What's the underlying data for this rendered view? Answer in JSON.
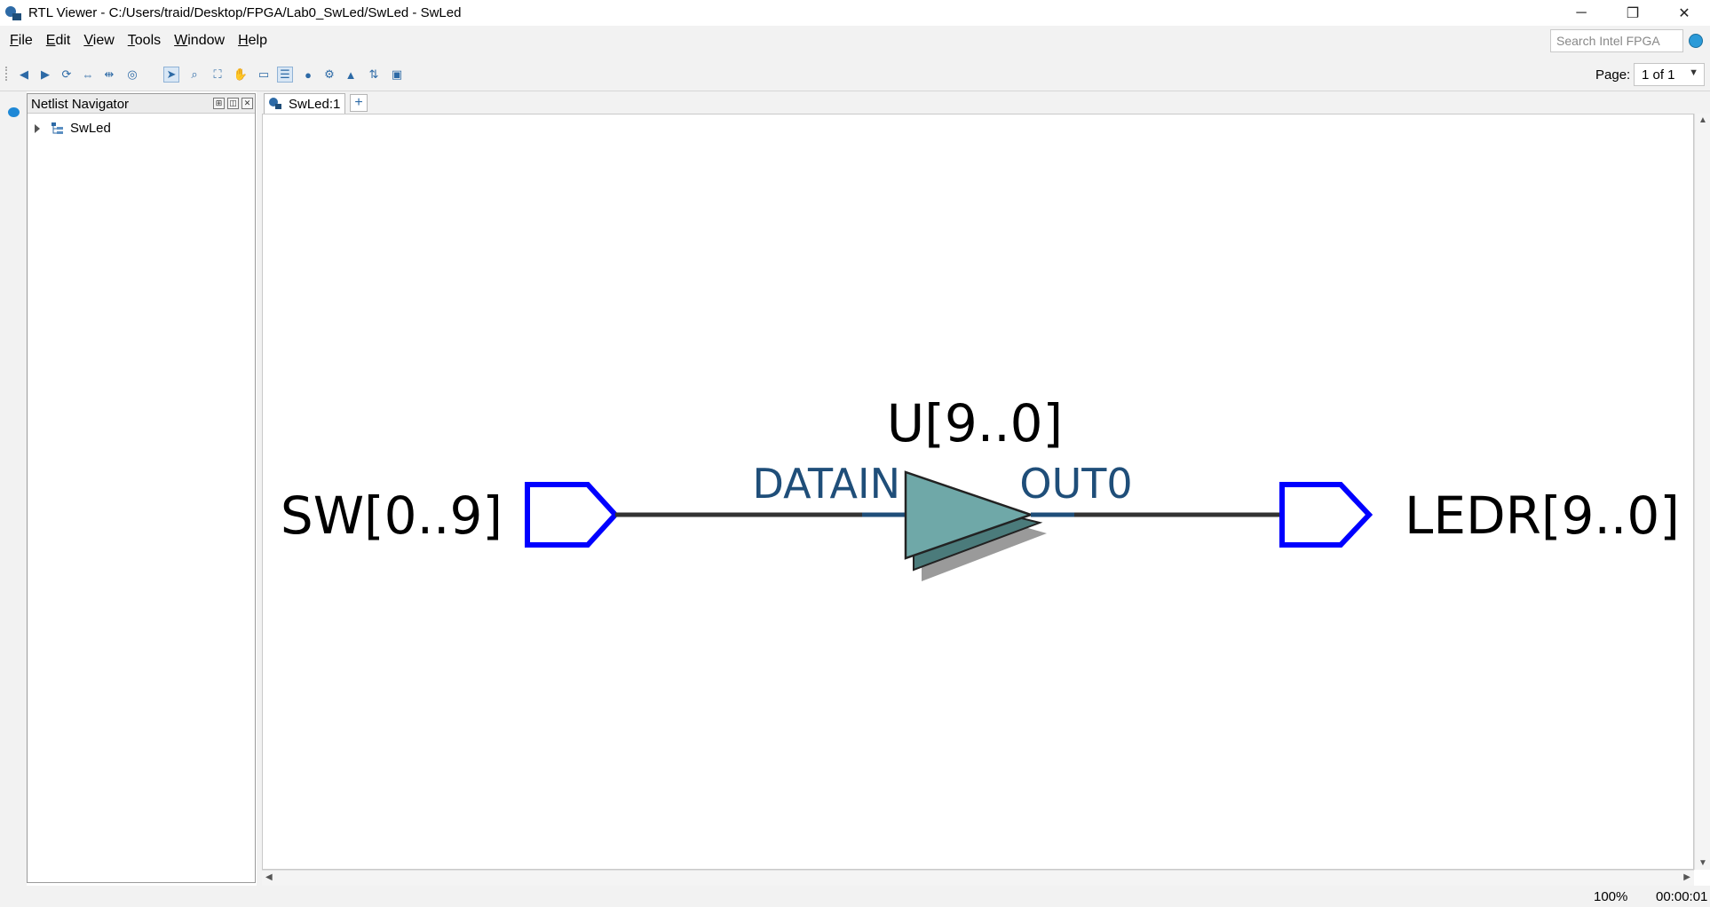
{
  "window": {
    "title": "RTL Viewer - C:/Users/traid/Desktop/FPGA/Lab0_SwLed/SwLed - SwLed",
    "controls": {
      "minimize": "─",
      "restore": "❐",
      "close": "✕"
    }
  },
  "menu": {
    "items": [
      {
        "underline": "F",
        "rest": "ile"
      },
      {
        "underline": "E",
        "rest": "dit"
      },
      {
        "underline": "V",
        "rest": "iew"
      },
      {
        "underline": "T",
        "rest": "ools"
      },
      {
        "underline": "W",
        "rest": "indow"
      },
      {
        "underline": "H",
        "rest": "elp"
      }
    ],
    "search_placeholder": "Search Intel FPGA"
  },
  "toolbar": {
    "page_label": "Page:",
    "page_value": "1 of 1"
  },
  "navigator": {
    "title": "Netlist Navigator",
    "tree_root": "SwLed"
  },
  "tabs": {
    "active": "SwLed:1",
    "add": "+"
  },
  "schematic": {
    "input_port": "SW[0..9]",
    "buffer_name": "U[9..0]",
    "buffer_in_pin": "DATAIN",
    "buffer_out_pin": "OUT0",
    "output_port": "LEDR[9..0]",
    "colors": {
      "port": "#0000ff",
      "wire": "#333333",
      "pin_text": "#1f4e79",
      "buffer_fill": "#6fa8a8",
      "buffer_shadow": "#4b7b7b"
    }
  },
  "status": {
    "zoom": "100%",
    "elapsed": "00:00:01"
  }
}
